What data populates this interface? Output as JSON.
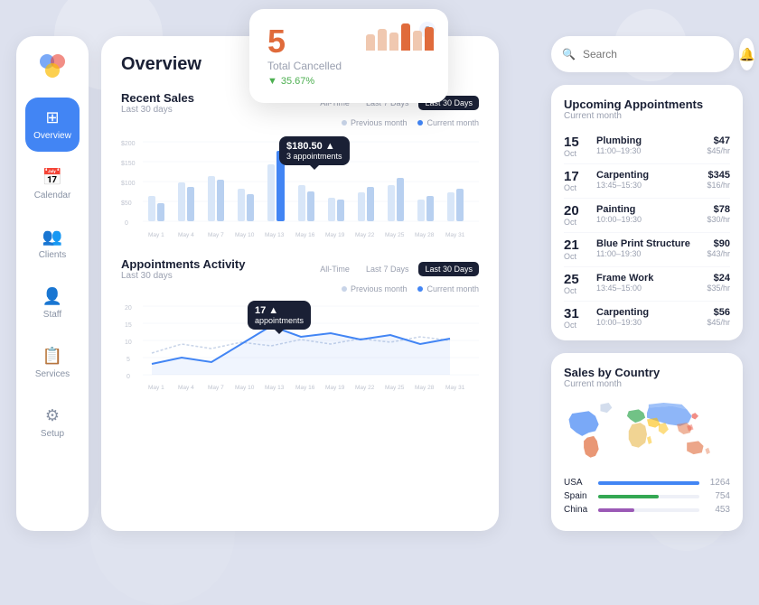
{
  "app": {
    "title": "Overview"
  },
  "sidebar": {
    "items": [
      {
        "label": "Overview",
        "icon": "⊞",
        "active": true
      },
      {
        "label": "Calendar",
        "icon": "📅",
        "active": false
      },
      {
        "label": "Clients",
        "icon": "👥",
        "active": false
      },
      {
        "label": "Staff",
        "icon": "👤",
        "active": false
      },
      {
        "label": "Services",
        "icon": "📋",
        "active": false
      },
      {
        "label": "Setup",
        "icon": "⚙",
        "active": false
      }
    ]
  },
  "cancelled_card": {
    "number": "5",
    "label": "Total Cancelled",
    "pct": "35.67%",
    "help_label": "?"
  },
  "recent_sales": {
    "title": "Recent Sales",
    "subtitle": "Last 30 days",
    "tabs": [
      "All-Time",
      "Last 7 Days",
      "Last 30 Days"
    ],
    "active_tab": "Last 30 Days",
    "legend": [
      "Previous month",
      "Current month"
    ],
    "tooltip": {
      "value": "$180.50",
      "sub": "3 appointments"
    },
    "x_labels": [
      "May 1",
      "May 4",
      "May 7",
      "May 10",
      "May 13",
      "May 16",
      "May 19",
      "May 22",
      "May 25",
      "May 28",
      "May 31"
    ],
    "y_labels": [
      "$200",
      "$150",
      "$100",
      "$50",
      "0"
    ]
  },
  "appointments_activity": {
    "title": "Appointments Activity",
    "subtitle": "Last 30 days",
    "tabs": [
      "All-Time",
      "Last 7 Days",
      "Last 30 Days"
    ],
    "active_tab": "Last 30 Days",
    "legend": [
      "Previous month",
      "Current month"
    ],
    "tooltip": {
      "value": "17",
      "sub": "appointments"
    },
    "x_labels": [
      "May 1",
      "May 4",
      "May 7",
      "May 10",
      "May 13",
      "May 16",
      "May 19",
      "May 22",
      "May 25",
      "May 28",
      "May 31"
    ],
    "y_labels": [
      "20",
      "15",
      "10",
      "5",
      "0"
    ]
  },
  "search": {
    "placeholder": "Search"
  },
  "upcoming": {
    "title": "Upcoming Appointments",
    "subtitle": "Current month",
    "items": [
      {
        "day": "15",
        "month": "Oct",
        "name": "Plumbing",
        "time": "11:00–19:30",
        "amount": "$47",
        "rate": "$45/hr"
      },
      {
        "day": "17",
        "month": "Oct",
        "name": "Carpenting",
        "time": "13:45–15:30",
        "amount": "$345",
        "rate": "$16/hr"
      },
      {
        "day": "20",
        "month": "Oct",
        "name": "Painting",
        "time": "10:00–19:30",
        "amount": "$78",
        "rate": "$30/hr"
      },
      {
        "day": "21",
        "month": "Oct",
        "name": "Blue Print Structure",
        "time": "11:00–19:30",
        "amount": "$90",
        "rate": "$43/hr"
      },
      {
        "day": "25",
        "month": "Oct",
        "name": "Frame Work",
        "time": "13:45–15:00",
        "amount": "$24",
        "rate": "$35/hr"
      },
      {
        "day": "31",
        "month": "Oct",
        "name": "Carpenting",
        "time": "10:00–19:30",
        "amount": "$56",
        "rate": "$45/hr"
      }
    ]
  },
  "sales_by_country": {
    "title": "Sales by Country",
    "subtitle": "Current month",
    "countries": [
      {
        "name": "USA",
        "value": 1264,
        "color": "#4285f4",
        "pct": 100
      },
      {
        "name": "Spain",
        "value": 754,
        "color": "#34a853",
        "pct": 60
      },
      {
        "name": "China",
        "value": 453,
        "color": "#9b59b6",
        "pct": 36
      }
    ]
  }
}
